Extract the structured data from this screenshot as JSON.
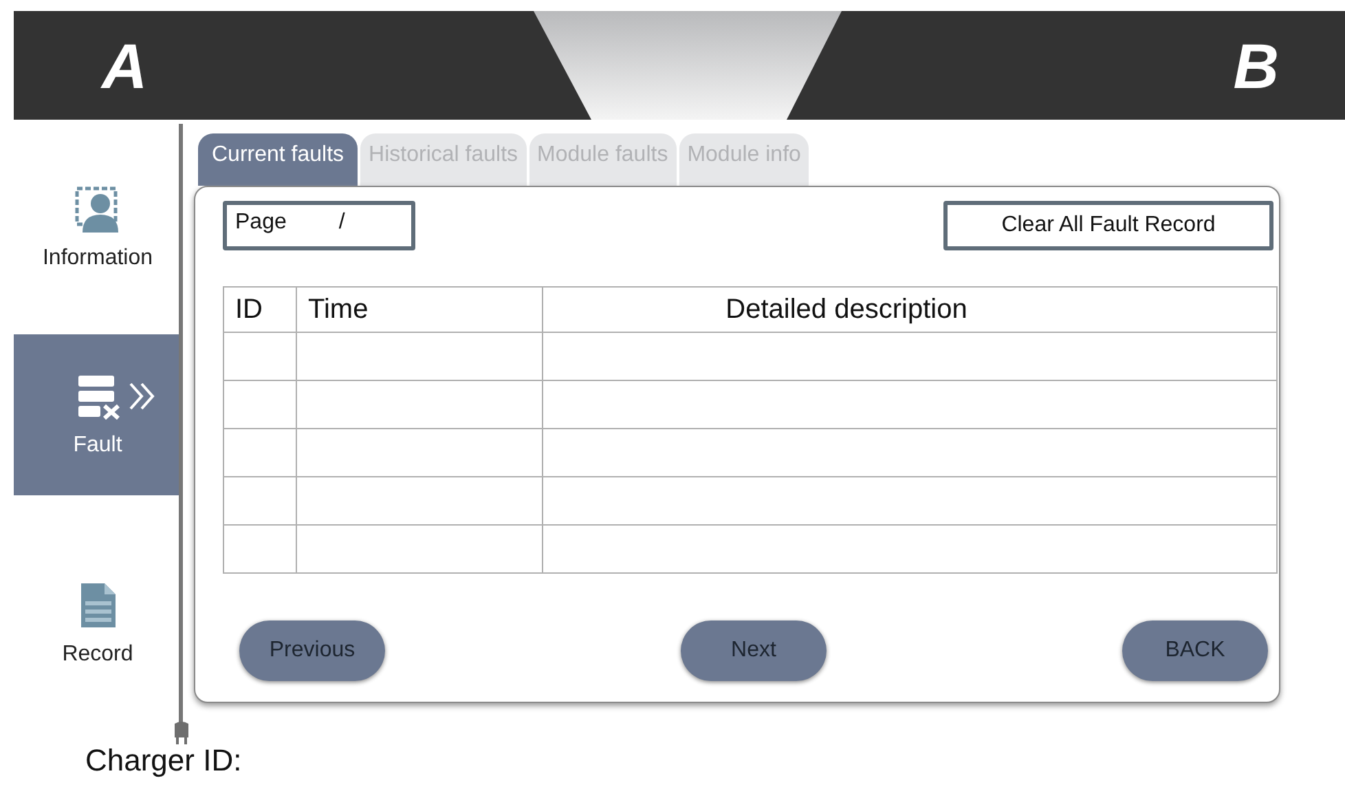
{
  "header": {
    "left": "A",
    "right": "B"
  },
  "sidebar": {
    "items": [
      {
        "label": "Information",
        "kind": "person",
        "selected": false
      },
      {
        "label": "Fault",
        "kind": "fault",
        "selected": true
      },
      {
        "label": "Record",
        "kind": "document",
        "selected": false
      }
    ]
  },
  "tabs": [
    {
      "label": "Current faults",
      "selected": true
    },
    {
      "label": "Historical faults",
      "selected": false
    },
    {
      "label": "Module faults",
      "selected": false
    },
    {
      "label": "Module info",
      "selected": false
    }
  ],
  "page_field": {
    "label": "Page",
    "separator": "/"
  },
  "clear_button": "Clear All Fault Record",
  "table": {
    "columns": [
      "ID",
      "Time",
      "Detailed description"
    ]
  },
  "buttons": [
    "Previous",
    "Next",
    "BACK"
  ],
  "footer": {
    "charger_id_label": "Charger ID:"
  }
}
